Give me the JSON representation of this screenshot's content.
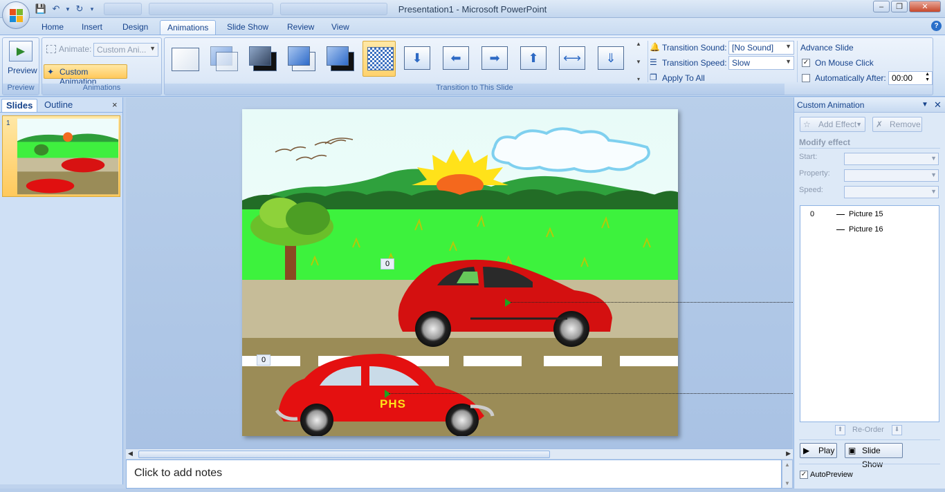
{
  "window": {
    "title": "Presentation1 - Microsoft PowerPoint",
    "background_tabs": [
      "",
      "",
      ""
    ]
  },
  "ribbon_tabs": [
    "Home",
    "Insert",
    "Design",
    "Animations",
    "Slide Show",
    "Review",
    "View"
  ],
  "active_tab": "Animations",
  "ribbon": {
    "preview": {
      "label": "Preview",
      "group": "Preview"
    },
    "animations": {
      "animate_label": "Animate:",
      "animate_value": "Custom Ani...",
      "custom_animation_button": "Custom Animation",
      "group": "Animations"
    },
    "transition": {
      "group": "Transition to This Slide",
      "sound_label": "Transition Sound:",
      "sound_value": "[No Sound]",
      "speed_label": "Transition Speed:",
      "speed_value": "Slow",
      "apply_all": "Apply To All"
    },
    "advance": {
      "title": "Advance Slide",
      "on_mouse_click": "On Mouse Click",
      "on_mouse_click_checked": true,
      "automatically_after": "Automatically After:",
      "automatically_after_checked": false,
      "time": "00:00"
    }
  },
  "left_pane": {
    "tabs": [
      "Slides",
      "Outline"
    ],
    "slide_number": "1",
    "close": "×"
  },
  "slide": {
    "car_label": "PHS",
    "tag_top": "0",
    "tag_bottom": "0"
  },
  "notes_placeholder": "Click to add notes",
  "custom_animation_pane": {
    "title": "Custom Animation",
    "add_effect": "Add Effect",
    "remove": "Remove",
    "modify_effect": "Modify effect",
    "start_label": "Start:",
    "property_label": "Property:",
    "speed_label": "Speed:",
    "list": [
      {
        "index": "0",
        "name": "Picture 15"
      },
      {
        "index": "",
        "name": "Picture 16"
      }
    ],
    "reorder": "Re-Order",
    "play": "Play",
    "slide_show": "Slide Show",
    "autopreview": "AutoPreview",
    "autopreview_checked": true
  }
}
